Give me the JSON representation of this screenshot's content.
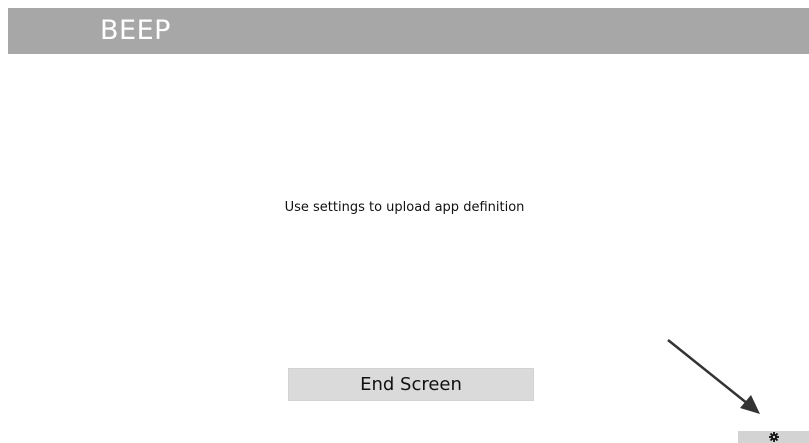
{
  "header": {
    "title": "BEEP"
  },
  "main": {
    "message": "Use settings to upload app definition",
    "end_screen_label": "End Screen"
  },
  "settings": {
    "icon": "gear-icon"
  },
  "annotation": {
    "icon": "arrow-icon"
  },
  "colors": {
    "header_bg": "#a7a7a7",
    "button_bg": "#dadada",
    "settings_bg": "#d3d3d3"
  }
}
